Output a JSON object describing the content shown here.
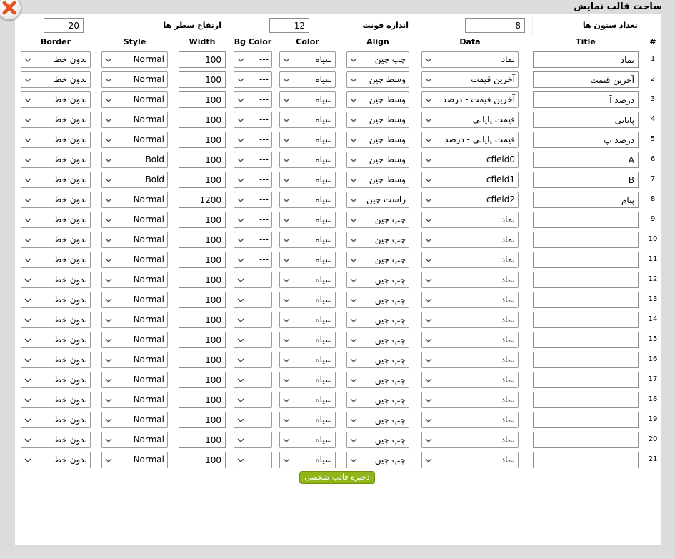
{
  "dialog": {
    "title": "ساخت قالب نمایش"
  },
  "settings": {
    "column_count_label": "تعداد ستون ها",
    "column_count_value": "8",
    "font_size_label": "اندازه فونت",
    "font_size_value": "12",
    "row_height_label": "ارتفاع سطر ها",
    "row_height_value": "20"
  },
  "headers": {
    "num": "#",
    "title": "Title",
    "data": "Data",
    "align": "Align",
    "color": "Color",
    "bgcolor": "Bg Color",
    "width": "Width",
    "style": "Style",
    "border": "Border"
  },
  "rows": [
    {
      "num": "1",
      "title": "نماد",
      "data": "نماد",
      "align": "چپ چین",
      "color": "سیاه",
      "bg": "---",
      "width": "100",
      "style": "Normal",
      "border": "بدون خط"
    },
    {
      "num": "2",
      "title": "آخرین قیمت",
      "data": "آخرین قیمت",
      "align": "وسط چین",
      "color": "سیاه",
      "bg": "---",
      "width": "100",
      "style": "Normal",
      "border": "بدون خط"
    },
    {
      "num": "3",
      "title": "درصد آ",
      "data": "آخرین قیمت - درصد",
      "align": "وسط چین",
      "color": "سیاه",
      "bg": "---",
      "width": "100",
      "style": "Normal",
      "border": "بدون خط"
    },
    {
      "num": "4",
      "title": "پایانی",
      "data": "قیمت پایانی",
      "align": "وسط چین",
      "color": "سیاه",
      "bg": "---",
      "width": "100",
      "style": "Normal",
      "border": "بدون خط"
    },
    {
      "num": "5",
      "title": "درصد پ",
      "data": "قیمت پایانی - درصد",
      "align": "وسط چین",
      "color": "سیاه",
      "bg": "---",
      "width": "100",
      "style": "Normal",
      "border": "بدون خط"
    },
    {
      "num": "6",
      "title": "A",
      "data": "cfield0",
      "align": "وسط چین",
      "color": "سیاه",
      "bg": "---",
      "width": "100",
      "style": "Bold",
      "border": "بدون خط"
    },
    {
      "num": "7",
      "title": "B",
      "data": "cfield1",
      "align": "وسط چین",
      "color": "سیاه",
      "bg": "---",
      "width": "100",
      "style": "Bold",
      "border": "بدون خط"
    },
    {
      "num": "8",
      "title": "پیام",
      "data": "cfield2",
      "align": "راست چین",
      "color": "سیاه",
      "bg": "---",
      "width": "1200",
      "style": "Normal",
      "border": "بدون خط"
    },
    {
      "num": "9",
      "title": "",
      "data": "نماد",
      "align": "چپ چین",
      "color": "سیاه",
      "bg": "---",
      "width": "100",
      "style": "Normal",
      "border": "بدون خط"
    },
    {
      "num": "10",
      "title": "",
      "data": "نماد",
      "align": "چپ چین",
      "color": "سیاه",
      "bg": "---",
      "width": "100",
      "style": "Normal",
      "border": "بدون خط"
    },
    {
      "num": "11",
      "title": "",
      "data": "نماد",
      "align": "چپ چین",
      "color": "سیاه",
      "bg": "---",
      "width": "100",
      "style": "Normal",
      "border": "بدون خط"
    },
    {
      "num": "12",
      "title": "",
      "data": "نماد",
      "align": "چپ چین",
      "color": "سیاه",
      "bg": "---",
      "width": "100",
      "style": "Normal",
      "border": "بدون خط"
    },
    {
      "num": "13",
      "title": "",
      "data": "نماد",
      "align": "چپ چین",
      "color": "سیاه",
      "bg": "---",
      "width": "100",
      "style": "Normal",
      "border": "بدون خط"
    },
    {
      "num": "14",
      "title": "",
      "data": "نماد",
      "align": "چپ چین",
      "color": "سیاه",
      "bg": "---",
      "width": "100",
      "style": "Normal",
      "border": "بدون خط"
    },
    {
      "num": "15",
      "title": "",
      "data": "نماد",
      "align": "چپ چین",
      "color": "سیاه",
      "bg": "---",
      "width": "100",
      "style": "Normal",
      "border": "بدون خط"
    },
    {
      "num": "16",
      "title": "",
      "data": "نماد",
      "align": "چپ چین",
      "color": "سیاه",
      "bg": "---",
      "width": "100",
      "style": "Normal",
      "border": "بدون خط"
    },
    {
      "num": "17",
      "title": "",
      "data": "نماد",
      "align": "چپ چین",
      "color": "سیاه",
      "bg": "---",
      "width": "100",
      "style": "Normal",
      "border": "بدون خط"
    },
    {
      "num": "18",
      "title": "",
      "data": "نماد",
      "align": "چپ چین",
      "color": "سیاه",
      "bg": "---",
      "width": "100",
      "style": "Normal",
      "border": "بدون خط"
    },
    {
      "num": "19",
      "title": "",
      "data": "نماد",
      "align": "چپ چین",
      "color": "سیاه",
      "bg": "---",
      "width": "100",
      "style": "Normal",
      "border": "بدون خط"
    },
    {
      "num": "20",
      "title": "",
      "data": "نماد",
      "align": "چپ چین",
      "color": "سیاه",
      "bg": "---",
      "width": "100",
      "style": "Normal",
      "border": "بدون خط"
    },
    {
      "num": "21",
      "title": "",
      "data": "نماد",
      "align": "چپ چین",
      "color": "سیاه",
      "bg": "---",
      "width": "100",
      "style": "Normal",
      "border": "بدون خط"
    }
  ],
  "save_button_label": "ذخیره قالب شخصی",
  "icons": {
    "close": "close-icon",
    "dropdown": "chevron-down-icon"
  },
  "colors": {
    "save_button": "#8fb516",
    "close_x": "#e8531f",
    "dialog_frame": "#dcdcdc",
    "panel": "#ffffff"
  }
}
